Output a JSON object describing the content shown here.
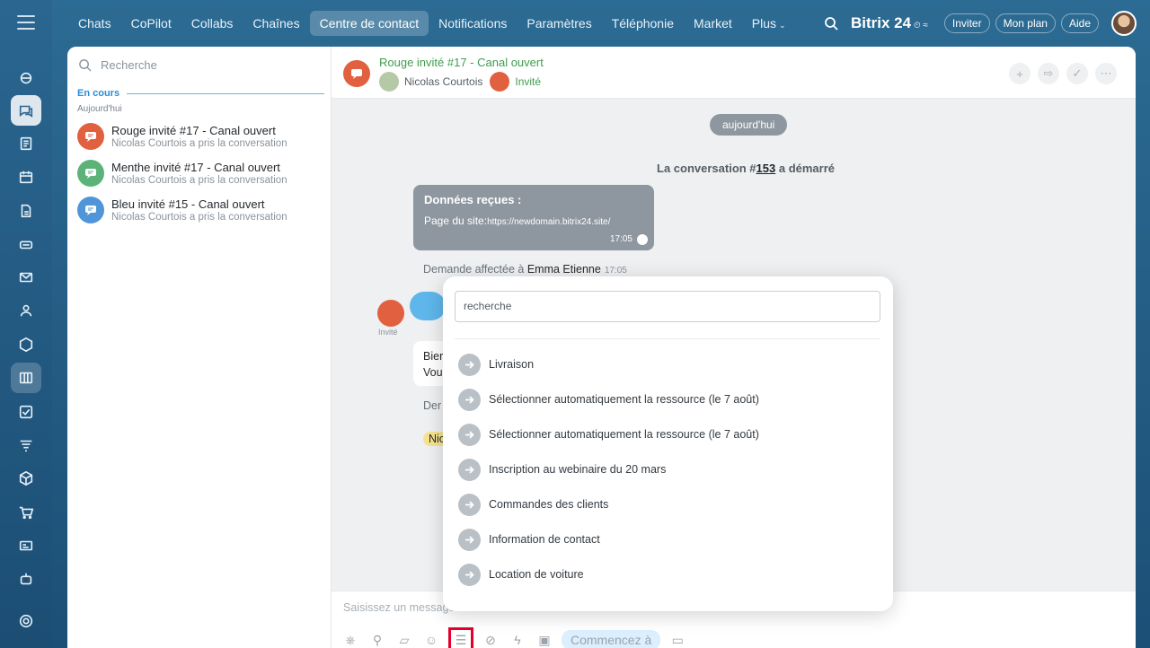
{
  "nav": {
    "tabs": [
      "Chats",
      "CoPilot",
      "Collabs",
      "Chaînes",
      "Centre de contact",
      "Notifications",
      "Paramètres",
      "Téléphonie",
      "Market",
      "Plus"
    ],
    "active_index": 4
  },
  "header": {
    "brand": "Bitrix 24",
    "invite": "Inviter",
    "plan": "Mon plan",
    "help": "Aide"
  },
  "sidebar_rail": {
    "icons": [
      "menu-icon",
      "copilot-icon",
      "chat-icon",
      "document-icon",
      "calendar-icon",
      "file-icon",
      "drive-icon",
      "mail-icon",
      "contacts-icon",
      "hexagon-icon",
      "kanban-icon",
      "tasks-icon",
      "filter-icon",
      "box-icon",
      "cart-icon",
      "card-icon",
      "robot-icon",
      "settings-icon"
    ]
  },
  "conversation_list": {
    "search_placeholder": "Recherche",
    "section_label": "En cours",
    "day_label": "Aujourd'hui",
    "items": [
      {
        "title": "Rouge invité #17 - Canal ouvert",
        "subtitle": "Nicolas Courtois a pris la conversation",
        "color": "#e0603f"
      },
      {
        "title": "Menthe invité #17 - Canal ouvert",
        "subtitle": "Nicolas Courtois a pris la conversation",
        "color": "#5cb37a"
      },
      {
        "title": "Bleu invité #15 - Canal ouvert",
        "subtitle": "Nicolas Courtois a pris la conversation",
        "color": "#4f95d8"
      }
    ]
  },
  "chat": {
    "title": "Rouge invité #17 - Canal ouvert",
    "operator": "Nicolas Courtois",
    "guest_label": "Invité",
    "day_pill": "aujourd'hui",
    "started_prefix": "La conversation #",
    "started_number": "153",
    "started_suffix": " a démarré",
    "received_title": "Données reçues :",
    "received_label": "Page du site:",
    "received_url": "https://newdomain.bitrix24.site/",
    "received_time": "17:05",
    "assigned_prefix": "Demande affectée à ",
    "assigned_name": "Emma Etienne",
    "assigned_time": "17:05",
    "guest_avatar_label": "Invité",
    "partial_1a": "Bier",
    "partial_1b": "Vou",
    "partial_2": "Der",
    "partial_3": "Nic",
    "composer_placeholder": "Saisissez un message",
    "start_chip": "Commencez à"
  },
  "popup": {
    "search_placeholder": "recherche",
    "items": [
      "Livraison",
      "Sélectionner automatiquement la ressource (le 7 août)",
      "Sélectionner automatiquement la ressource (le 7 août)",
      "Inscription au webinaire du 20 mars",
      "Commandes des clients",
      "Information de contact",
      "Location de voiture"
    ]
  },
  "colors": {
    "accent": "#2a8dd4",
    "open_channel_green": "#3f9c4e",
    "highlight_red": "#e4002b"
  }
}
